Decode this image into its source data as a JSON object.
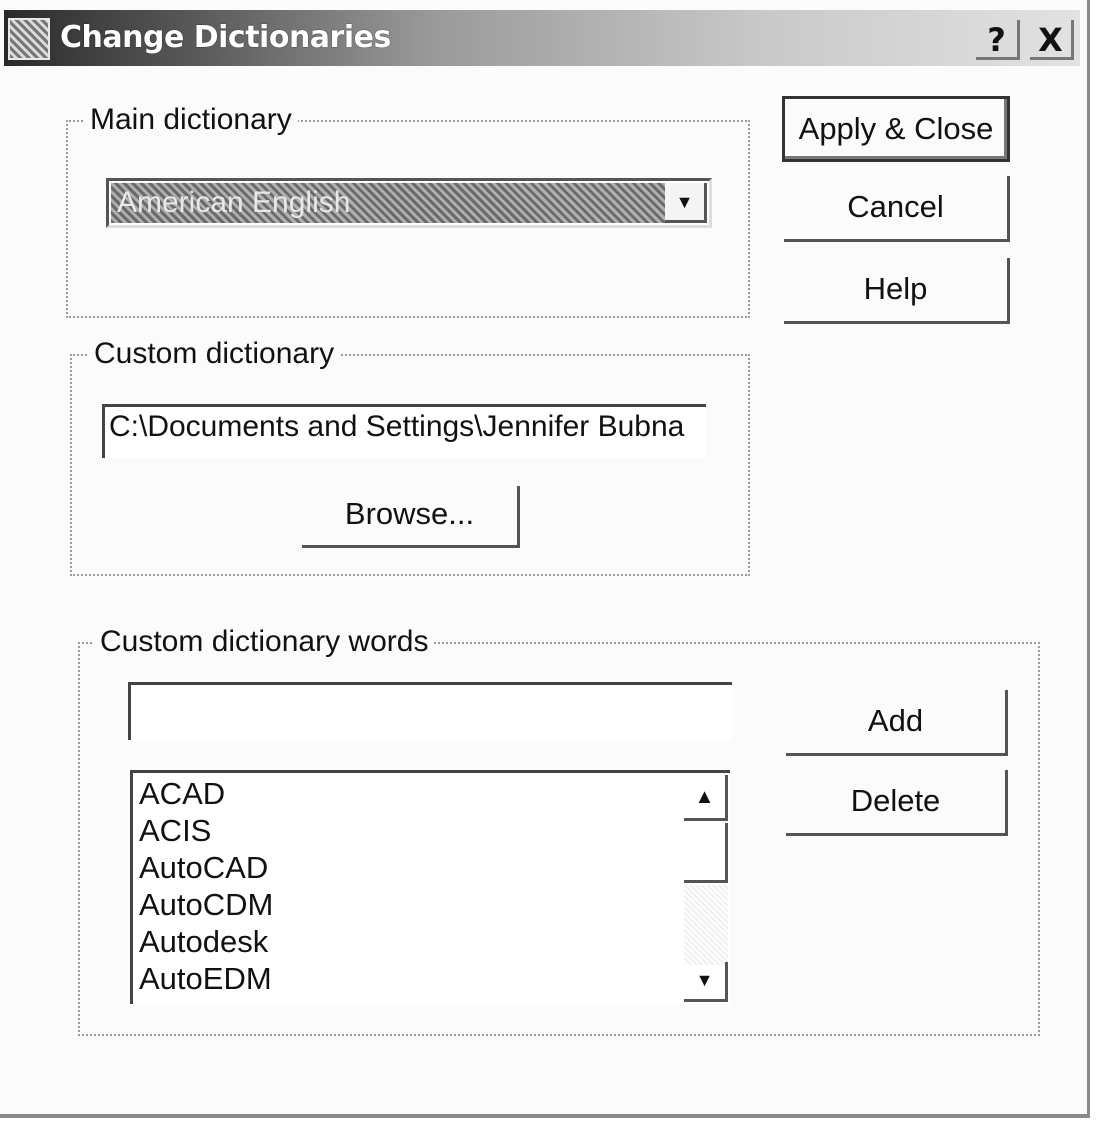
{
  "window": {
    "title": "Change Dictionaries",
    "help_button": "?",
    "close_button": "X"
  },
  "main_dictionary": {
    "group_label": "Main dictionary",
    "selected": "American English"
  },
  "custom_dictionary": {
    "group_label": "Custom dictionary",
    "path": "C:\\Documents and Settings\\Jennifer Bubna",
    "browse_label": "Browse..."
  },
  "custom_words": {
    "group_label": "Custom dictionary words",
    "input_value": "",
    "items": [
      "ACAD",
      "ACIS",
      "AutoCAD",
      "AutoCDM",
      "Autodesk",
      "AutoEDM"
    ],
    "add_label": "Add",
    "delete_label": "Delete"
  },
  "actions": {
    "apply_close_label": "Apply & Close",
    "cancel_label": "Cancel",
    "help_label": "Help"
  }
}
